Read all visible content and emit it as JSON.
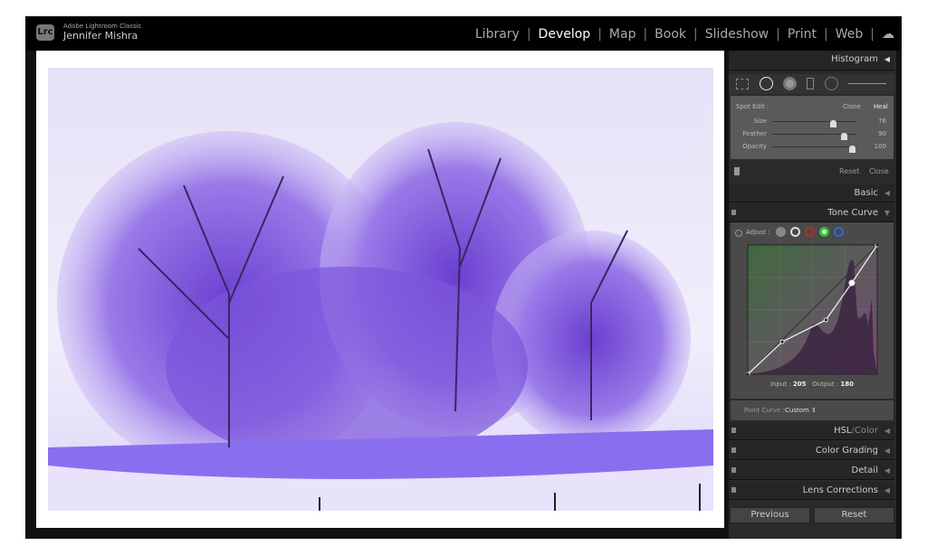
{
  "app": {
    "product": "Adobe Lightroom Classic",
    "user": "Jennifer Mishra",
    "logo": "Lrc"
  },
  "modules": [
    "Library",
    "Develop",
    "Map",
    "Book",
    "Slideshow",
    "Print",
    "Web"
  ],
  "active_module": "Develop",
  "panel": {
    "histogram": "Histogram",
    "spot_edit": {
      "label": "Spot Edit :",
      "clone": "Clone",
      "heal": "Heal",
      "sliders": [
        {
          "label": "Size",
          "value": "76",
          "pct": 0.76
        },
        {
          "label": "Feather",
          "value": "90",
          "pct": 0.9
        },
        {
          "label": "Opacity",
          "value": "100",
          "pct": 1.0
        }
      ],
      "reset": "Reset",
      "close": "Close"
    },
    "basic": "Basic",
    "tone_curve": {
      "title": "Tone Curve",
      "adjust": "Adjust :",
      "input_label": "Input :",
      "input": "205",
      "output_label": "Output :",
      "output": "180",
      "point_curve_label": "Point Curve :",
      "point_curve": "Custom",
      "points": [
        [
          0,
          0
        ],
        [
          68,
          64
        ],
        [
          154,
          107
        ],
        [
          205,
          180
        ],
        [
          255,
          255
        ]
      ]
    },
    "hsl": "HSL",
    "hsl_color": "Color",
    "hsl_sep": "/",
    "color_grading": "Color Grading",
    "detail": "Detail",
    "lens": "Lens Corrections",
    "previous": "Previous",
    "reset": "Reset"
  },
  "colors": {
    "red": "#c02828",
    "green": "#2ec42e",
    "blue": "#2a6ad8"
  }
}
